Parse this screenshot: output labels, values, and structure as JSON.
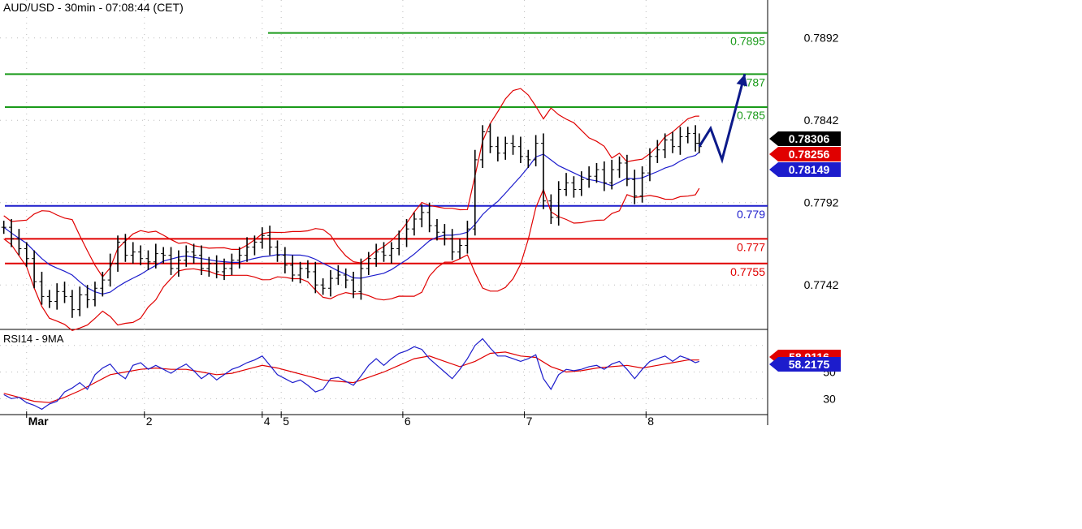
{
  "chart_data": {
    "type": "line",
    "title": "AUD/USD - 30min - 07:08:44 (CET)",
    "price_panel": {
      "ylim": [
        0.7715,
        0.7915
      ],
      "y_ticks": [
        "0.7892",
        "0.7842",
        "0.7792",
        "0.7742"
      ],
      "y_tick_values": [
        0.7892,
        0.7842,
        0.7792,
        0.7742
      ],
      "price_tags": [
        {
          "label": "0.78306",
          "value": 0.78306,
          "color": "#000000"
        },
        {
          "label": "0.78256",
          "value": 0.78256,
          "color": "#e00000"
        },
        {
          "label": "0.78149",
          "value": 0.78149,
          "color": "#1c1ccc"
        }
      ],
      "resistance_levels": [
        {
          "label": "0.7895",
          "value": 0.7895
        },
        {
          "label": ".787",
          "value": 0.787
        },
        {
          "label": "0.785",
          "value": 0.785
        }
      ],
      "pivot_levels": [
        {
          "label": "0.779",
          "value": 0.779
        }
      ],
      "support_levels": [
        {
          "label": "0.777",
          "value": 0.777
        },
        {
          "label": "0.7755",
          "value": 0.7755
        }
      ],
      "close_series": [
        [
          1,
          0.7777
        ],
        [
          3,
          0.777
        ],
        [
          5,
          0.7764
        ],
        [
          7,
          0.7758
        ],
        [
          9,
          0.7744
        ],
        [
          11,
          0.7735
        ],
        [
          13,
          0.7732
        ],
        [
          15,
          0.7738
        ],
        [
          17,
          0.7735
        ],
        [
          19,
          0.7727
        ],
        [
          21,
          0.7736
        ],
        [
          23,
          0.7733
        ],
        [
          25,
          0.774
        ],
        [
          27,
          0.7745
        ],
        [
          29,
          0.7755
        ],
        [
          31,
          0.7768
        ],
        [
          33,
          0.776
        ],
        [
          35,
          0.7762
        ],
        [
          37,
          0.7758
        ],
        [
          39,
          0.7756
        ],
        [
          41,
          0.7761
        ],
        [
          43,
          0.776
        ],
        [
          45,
          0.7752
        ],
        [
          47,
          0.7757
        ],
        [
          49,
          0.7762
        ],
        [
          51,
          0.776
        ],
        [
          53,
          0.7752
        ],
        [
          55,
          0.7755
        ],
        [
          57,
          0.775
        ],
        [
          59,
          0.7752
        ],
        [
          61,
          0.7757
        ],
        [
          63,
          0.776
        ],
        [
          65,
          0.7765
        ],
        [
          67,
          0.7768
        ],
        [
          69,
          0.7772
        ],
        [
          71,
          0.7765
        ],
        [
          73,
          0.776
        ],
        [
          75,
          0.7754
        ],
        [
          77,
          0.7748
        ],
        [
          79,
          0.7752
        ],
        [
          81,
          0.775
        ],
        [
          83,
          0.7742
        ],
        [
          85,
          0.774
        ],
        [
          87,
          0.7746
        ],
        [
          89,
          0.7748
        ],
        [
          91,
          0.7745
        ],
        [
          93,
          0.7738
        ],
        [
          95,
          0.7752
        ],
        [
          97,
          0.7758
        ],
        [
          99,
          0.7762
        ],
        [
          101,
          0.776
        ],
        [
          103,
          0.7764
        ],
        [
          105,
          0.777
        ],
        [
          107,
          0.7776
        ],
        [
          109,
          0.7782
        ],
        [
          111,
          0.7786
        ],
        [
          113,
          0.7778
        ],
        [
          115,
          0.7774
        ],
        [
          117,
          0.777
        ],
        [
          119,
          0.7762
        ],
        [
          121,
          0.7766
        ],
        [
          123,
          0.7776
        ],
        [
          125,
          0.7818
        ],
        [
          127,
          0.7835
        ],
        [
          129,
          0.7826
        ],
        [
          131,
          0.7822
        ],
        [
          133,
          0.7828
        ],
        [
          135,
          0.7826
        ],
        [
          137,
          0.782
        ],
        [
          139,
          0.7818
        ],
        [
          141,
          0.7828
        ],
        [
          143,
          0.7793
        ],
        [
          145,
          0.7783
        ],
        [
          147,
          0.78
        ],
        [
          149,
          0.7804
        ],
        [
          151,
          0.78
        ],
        [
          153,
          0.7806
        ],
        [
          155,
          0.7808
        ],
        [
          157,
          0.7812
        ],
        [
          159,
          0.7804
        ],
        [
          161,
          0.7812
        ],
        [
          163,
          0.7816
        ],
        [
          165,
          0.7806
        ],
        [
          167,
          0.7796
        ],
        [
          169,
          0.781
        ],
        [
          171,
          0.782
        ],
        [
          173,
          0.7824
        ],
        [
          175,
          0.783
        ],
        [
          177,
          0.7826
        ],
        [
          179,
          0.7832
        ],
        [
          181,
          0.7834
        ],
        [
          183,
          0.7828
        ],
        [
          184,
          0.7826
        ]
      ],
      "projection": [
        [
          184,
          0.7826
        ],
        [
          187,
          0.7837
        ],
        [
          190,
          0.7818
        ],
        [
          196,
          0.787
        ]
      ]
    },
    "rsi_panel": {
      "label": "RSI14 - 9MA",
      "ylim": [
        18,
        82
      ],
      "y_ticks": [
        "50",
        "30"
      ],
      "y_tick_values": [
        50,
        30
      ],
      "rsi_tags": [
        {
          "label": "58.9116",
          "value": 61.5,
          "color": "#e00000"
        },
        {
          "label": "58.2175",
          "value": 55.5,
          "color": "#1c1ccc"
        }
      ],
      "rsi_series": [
        [
          1,
          33
        ],
        [
          3,
          30
        ],
        [
          5,
          31
        ],
        [
          7,
          27
        ],
        [
          9,
          25
        ],
        [
          11,
          22
        ],
        [
          13,
          26
        ],
        [
          15,
          28
        ],
        [
          17,
          35
        ],
        [
          19,
          38
        ],
        [
          21,
          42
        ],
        [
          23,
          37
        ],
        [
          25,
          48
        ],
        [
          27,
          53
        ],
        [
          29,
          56
        ],
        [
          31,
          49
        ],
        [
          33,
          45
        ],
        [
          35,
          55
        ],
        [
          37,
          57
        ],
        [
          39,
          52
        ],
        [
          41,
          55
        ],
        [
          43,
          52
        ],
        [
          45,
          49
        ],
        [
          47,
          53
        ],
        [
          49,
          56
        ],
        [
          51,
          51
        ],
        [
          53,
          45
        ],
        [
          55,
          49
        ],
        [
          57,
          44
        ],
        [
          59,
          48
        ],
        [
          61,
          52
        ],
        [
          63,
          54
        ],
        [
          65,
          57
        ],
        [
          67,
          59
        ],
        [
          69,
          62
        ],
        [
          71,
          55
        ],
        [
          73,
          48
        ],
        [
          75,
          45
        ],
        [
          77,
          42
        ],
        [
          79,
          44
        ],
        [
          81,
          40
        ],
        [
          83,
          35
        ],
        [
          85,
          37
        ],
        [
          87,
          45
        ],
        [
          89,
          46
        ],
        [
          91,
          43
        ],
        [
          93,
          40
        ],
        [
          95,
          47
        ],
        [
          97,
          55
        ],
        [
          99,
          60
        ],
        [
          101,
          55
        ],
        [
          103,
          60
        ],
        [
          105,
          64
        ],
        [
          107,
          66
        ],
        [
          109,
          69
        ],
        [
          111,
          67
        ],
        [
          113,
          60
        ],
        [
          115,
          55
        ],
        [
          117,
          50
        ],
        [
          119,
          45
        ],
        [
          121,
          52
        ],
        [
          123,
          60
        ],
        [
          125,
          70
        ],
        [
          127,
          75
        ],
        [
          129,
          68
        ],
        [
          131,
          62
        ],
        [
          133,
          62
        ],
        [
          135,
          60
        ],
        [
          137,
          58
        ],
        [
          139,
          60
        ],
        [
          141,
          63
        ],
        [
          143,
          45
        ],
        [
          145,
          37
        ],
        [
          147,
          48
        ],
        [
          149,
          52
        ],
        [
          151,
          51
        ],
        [
          153,
          52
        ],
        [
          155,
          54
        ],
        [
          157,
          55
        ],
        [
          159,
          52
        ],
        [
          161,
          56
        ],
        [
          163,
          58
        ],
        [
          165,
          52
        ],
        [
          167,
          45
        ],
        [
          169,
          52
        ],
        [
          171,
          58
        ],
        [
          173,
          60
        ],
        [
          175,
          62
        ],
        [
          177,
          58
        ],
        [
          179,
          62
        ],
        [
          181,
          60
        ],
        [
          183,
          57
        ],
        [
          184,
          58
        ]
      ],
      "rsi_ma_series": [
        [
          1,
          34
        ],
        [
          5,
          31
        ],
        [
          9,
          28
        ],
        [
          13,
          27
        ],
        [
          17,
          31
        ],
        [
          21,
          36
        ],
        [
          25,
          42
        ],
        [
          29,
          48
        ],
        [
          33,
          50
        ],
        [
          37,
          52
        ],
        [
          41,
          53
        ],
        [
          45,
          52
        ],
        [
          49,
          52
        ],
        [
          53,
          50
        ],
        [
          57,
          48
        ],
        [
          61,
          49
        ],
        [
          65,
          52
        ],
        [
          69,
          55
        ],
        [
          73,
          53
        ],
        [
          77,
          50
        ],
        [
          81,
          47
        ],
        [
          85,
          44
        ],
        [
          89,
          43
        ],
        [
          93,
          42
        ],
        [
          97,
          46
        ],
        [
          101,
          50
        ],
        [
          105,
          55
        ],
        [
          109,
          60
        ],
        [
          113,
          62
        ],
        [
          117,
          58
        ],
        [
          121,
          54
        ],
        [
          125,
          58
        ],
        [
          129,
          64
        ],
        [
          133,
          65
        ],
        [
          137,
          62
        ],
        [
          141,
          61
        ],
        [
          145,
          54
        ],
        [
          149,
          50
        ],
        [
          153,
          51
        ],
        [
          157,
          53
        ],
        [
          161,
          54
        ],
        [
          165,
          55
        ],
        [
          169,
          53
        ],
        [
          173,
          55
        ],
        [
          177,
          57
        ],
        [
          181,
          59
        ],
        [
          184,
          59
        ]
      ]
    },
    "x_axis": {
      "x_range": [
        0,
        202
      ],
      "ticks": [
        {
          "label": "Mar",
          "x": 7
        },
        {
          "label": "2",
          "x": 38
        },
        {
          "label": "4",
          "x": 69
        },
        {
          "label": "5",
          "x": 74
        },
        {
          "label": "6",
          "x": 106
        },
        {
          "label": "7",
          "x": 138
        },
        {
          "label": "8",
          "x": 170
        }
      ]
    },
    "colors": {
      "resistance": "#1a9a1a",
      "support": "#e00000",
      "pivot": "#1c1ccc",
      "band": "#e00000",
      "ma": "#1c1ccc",
      "price": "#000000",
      "projection": "#0c1a8a"
    },
    "grid": "dotted"
  }
}
